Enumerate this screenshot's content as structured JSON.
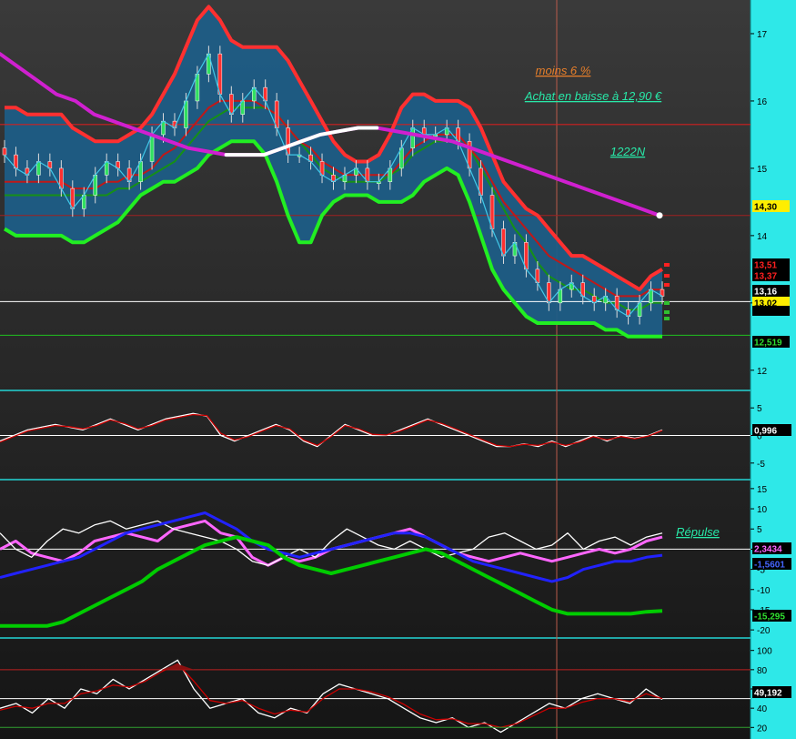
{
  "chart_data": [
    {
      "type": "candlestick",
      "panel": "price",
      "title": "",
      "annotations": [
        "moins 6 %",
        "Achat en baisse à 12,90 €",
        "1222N"
      ],
      "y_ticks": [
        17,
        16,
        15,
        14,
        13,
        12
      ],
      "ylim": [
        11.7,
        17.5
      ],
      "price_tags": [
        "14,30",
        "13,51",
        "13,37",
        "13,16",
        "13,02",
        "12,519"
      ],
      "levels": {
        "upper_red": 15.65,
        "mid_red": 14.3,
        "white": 13.02,
        "green": 12.519
      },
      "close": [
        15.2,
        15.0,
        14.9,
        15.1,
        15.0,
        14.7,
        14.4,
        14.6,
        14.9,
        15.1,
        15.0,
        14.8,
        15.1,
        15.5,
        15.7,
        15.6,
        16.0,
        16.4,
        16.7,
        16.1,
        15.8,
        16.0,
        16.2,
        16.0,
        15.6,
        15.2,
        15.2,
        15.1,
        14.9,
        14.8,
        14.9,
        15.0,
        14.8,
        14.8,
        15.0,
        15.3,
        15.6,
        15.5,
        15.5,
        15.6,
        15.4,
        15.0,
        14.6,
        14.1,
        13.7,
        13.9,
        13.5,
        13.3,
        13.0,
        13.2,
        13.3,
        13.1,
        13.0,
        13.1,
        12.9,
        12.8,
        13.0,
        13.2,
        13.1
      ],
      "ma_red": [
        14.8,
        14.8,
        14.8,
        14.8,
        14.8,
        14.8,
        14.7,
        14.7,
        14.7,
        14.8,
        14.8,
        14.9,
        14.9,
        15.0,
        15.2,
        15.3,
        15.5,
        15.7,
        15.9,
        16.0,
        16.0,
        16.0,
        16.0,
        15.9,
        15.8,
        15.6,
        15.4,
        15.3,
        15.1,
        15.0,
        14.9,
        14.9,
        14.9,
        14.9,
        14.9,
        15.1,
        15.3,
        15.4,
        15.5,
        15.5,
        15.5,
        15.3,
        15.1,
        14.8,
        14.5,
        14.3,
        14.1,
        13.9,
        13.7,
        13.6,
        13.5,
        13.4,
        13.3,
        13.2,
        13.1,
        13.1,
        13.1,
        13.2,
        13.2
      ],
      "ma_green": [
        14.6,
        14.6,
        14.6,
        14.6,
        14.6,
        14.6,
        14.6,
        14.6,
        14.6,
        14.6,
        14.7,
        14.7,
        14.8,
        14.9,
        15.0,
        15.1,
        15.3,
        15.5,
        15.7,
        15.8,
        15.9,
        15.9,
        15.9,
        15.9,
        15.8,
        15.6,
        15.4,
        15.2,
        15.0,
        14.9,
        14.8,
        14.8,
        14.8,
        14.8,
        14.9,
        15.0,
        15.2,
        15.3,
        15.4,
        15.4,
        15.4,
        15.3,
        15.0,
        14.7,
        14.4,
        14.1,
        13.9,
        13.6,
        13.4,
        13.3,
        13.2,
        13.2,
        13.1,
        13.0,
        13.0,
        12.9,
        12.9,
        13.0,
        13.0
      ],
      "bb_upper": [
        15.9,
        15.9,
        15.8,
        15.8,
        15.8,
        15.8,
        15.6,
        15.5,
        15.4,
        15.4,
        15.4,
        15.5,
        15.6,
        15.8,
        16.1,
        16.4,
        16.8,
        17.2,
        17.4,
        17.2,
        16.9,
        16.8,
        16.8,
        16.8,
        16.8,
        16.6,
        16.3,
        16.0,
        15.7,
        15.4,
        15.2,
        15.1,
        15.1,
        15.2,
        15.5,
        15.9,
        16.1,
        16.1,
        16.0,
        16.0,
        16.0,
        15.9,
        15.6,
        15.2,
        14.8,
        14.6,
        14.4,
        14.3,
        14.1,
        13.9,
        13.7,
        13.7,
        13.6,
        13.5,
        13.4,
        13.3,
        13.2,
        13.4,
        13.5
      ],
      "bb_lower": [
        14.1,
        14.0,
        14.0,
        14.0,
        14.0,
        14.0,
        13.9,
        13.9,
        14.0,
        14.1,
        14.2,
        14.4,
        14.6,
        14.7,
        14.8,
        14.8,
        14.9,
        15.0,
        15.2,
        15.3,
        15.4,
        15.4,
        15.4,
        15.2,
        14.8,
        14.3,
        13.9,
        13.9,
        14.3,
        14.5,
        14.6,
        14.6,
        14.6,
        14.5,
        14.5,
        14.5,
        14.6,
        14.8,
        14.9,
        15.0,
        14.9,
        14.5,
        14.0,
        13.5,
        13.2,
        13.0,
        12.8,
        12.7,
        12.7,
        12.7,
        12.7,
        12.7,
        12.7,
        12.6,
        12.6,
        12.5,
        12.5,
        12.5,
        12.5
      ],
      "long_ma": [
        16.7,
        16.5,
        16.3,
        16.1,
        16.0,
        15.8,
        15.7,
        15.6,
        15.5,
        15.4,
        15.3,
        15.25,
        15.2,
        15.2,
        15.2,
        15.3,
        15.4,
        15.5,
        15.55,
        15.6,
        15.6,
        15.55,
        15.5,
        15.45,
        15.4,
        15.3,
        15.2,
        15.1,
        15.0,
        14.9,
        14.8,
        14.7,
        14.6,
        14.5,
        14.4,
        14.3
      ]
    },
    {
      "type": "line",
      "panel": "oscillator-1",
      "title": "",
      "y_ticks": [
        5,
        0,
        -5
      ],
      "ylim": [
        -8,
        8
      ],
      "value_tag": "0,996",
      "series": [
        {
          "color": "#ffffff",
          "values": [
            -1,
            0,
            1,
            1.5,
            2,
            1.5,
            1,
            2,
            3,
            2,
            1,
            2,
            3,
            3.5,
            4,
            3.5,
            0,
            -1,
            0,
            1,
            2,
            1,
            -1,
            -2,
            0,
            2,
            1,
            0,
            0,
            1,
            2,
            3,
            2,
            1,
            0,
            -1,
            -2,
            -2,
            -1.5,
            -2,
            -1,
            -2,
            -1,
            0,
            -1,
            0,
            -0.5,
            0,
            1
          ]
        },
        {
          "color": "#cc0000",
          "values": [
            -1.2,
            -0.2,
            0.8,
            1.3,
            1.8,
            1.6,
            1.2,
            1.8,
            2.8,
            2.2,
            1.2,
            1.8,
            2.8,
            3.3,
            3.8,
            3.6,
            0.4,
            -0.8,
            -0.2,
            0.8,
            1.8,
            1.2,
            -0.8,
            -1.8,
            -0.2,
            1.8,
            1.2,
            0.2,
            0.1,
            0.8,
            1.8,
            2.8,
            2.2,
            1.2,
            0.2,
            -0.8,
            -1.8,
            -2,
            -1.6,
            -1.8,
            -1.2,
            -1.8,
            -1.2,
            -0.2,
            -0.8,
            -0.2,
            -0.6,
            -0.1,
            0.9
          ]
        }
      ]
    },
    {
      "type": "line",
      "panel": "oscillator-2",
      "title": "",
      "annotations": [
        "Répulse"
      ],
      "y_ticks": [
        15,
        10,
        5,
        0,
        -5,
        -10,
        -15,
        -20
      ],
      "ylim": [
        -22,
        17
      ],
      "value_tags": [
        "2,3434",
        "-1,5601",
        "-15,295"
      ],
      "series": [
        {
          "color": "#ff66ff",
          "values": [
            0,
            2,
            -1,
            -2,
            -3,
            -1,
            2,
            3,
            4,
            3,
            2,
            5,
            6,
            7,
            4,
            3,
            -2,
            -4,
            -2,
            -3,
            -2,
            0,
            1,
            2,
            3,
            4,
            5,
            3,
            1,
            -1,
            -2,
            -3,
            -2,
            -1,
            -2,
            -3,
            -2,
            -1,
            0,
            -1,
            0,
            2,
            3
          ]
        },
        {
          "color": "#ffffff",
          "values": [
            4,
            0,
            -2,
            2,
            5,
            4,
            6,
            7,
            5,
            6,
            7,
            5,
            4,
            3,
            2,
            0,
            -3,
            -4,
            -2,
            0,
            -2,
            2,
            5,
            3,
            1,
            0,
            2,
            0,
            -2,
            -1,
            0,
            3,
            4,
            2,
            0,
            1,
            4,
            0,
            2,
            3,
            1,
            3,
            4
          ]
        },
        {
          "color": "#2222ff",
          "values": [
            -7,
            -6,
            -5,
            -4,
            -3,
            -2,
            0,
            2,
            4,
            5,
            6,
            7,
            8,
            9,
            7,
            5,
            2,
            0,
            -1,
            -2,
            -1,
            0,
            1,
            2,
            3,
            4,
            4,
            3,
            1,
            -1,
            -3,
            -4,
            -5,
            -6,
            -7,
            -8,
            -7,
            -5,
            -4,
            -3,
            -3,
            -2,
            -1.5
          ]
        },
        {
          "color": "#00cc00",
          "values": [
            -19,
            -19,
            -19,
            -19,
            -18,
            -16,
            -14,
            -12,
            -10,
            -8,
            -5,
            -3,
            -1,
            1,
            2,
            3,
            2,
            1,
            -2,
            -4,
            -5,
            -6,
            -5,
            -4,
            -3,
            -2,
            -1,
            0,
            -1,
            -3,
            -5,
            -7,
            -9,
            -11,
            -13,
            -15,
            -16,
            -16,
            -16,
            -16,
            -16,
            -15.5,
            -15.3
          ]
        }
      ]
    },
    {
      "type": "line",
      "panel": "oscillator-3",
      "title": "",
      "y_ticks": [
        100,
        80,
        60,
        40,
        20
      ],
      "ylim": [
        8,
        112
      ],
      "value_tag": "49,192",
      "series": [
        {
          "color": "#ffffff",
          "values": [
            40,
            45,
            35,
            50,
            40,
            60,
            55,
            70,
            60,
            70,
            80,
            90,
            60,
            40,
            45,
            50,
            35,
            30,
            40,
            35,
            55,
            65,
            60,
            55,
            50,
            40,
            30,
            25,
            30,
            20,
            25,
            15,
            25,
            35,
            45,
            40,
            50,
            55,
            50,
            45,
            60,
            49
          ]
        },
        {
          "color": "#cc0000",
          "values": [
            38,
            42,
            40,
            45,
            45,
            55,
            58,
            64,
            62,
            68,
            78,
            86,
            68,
            48,
            45,
            48,
            40,
            34,
            38,
            36,
            50,
            60,
            60,
            57,
            52,
            44,
            34,
            28,
            29,
            24,
            24,
            20,
            24,
            32,
            40,
            40,
            46,
            50,
            50,
            47,
            55,
            50
          ]
        }
      ]
    }
  ]
}
